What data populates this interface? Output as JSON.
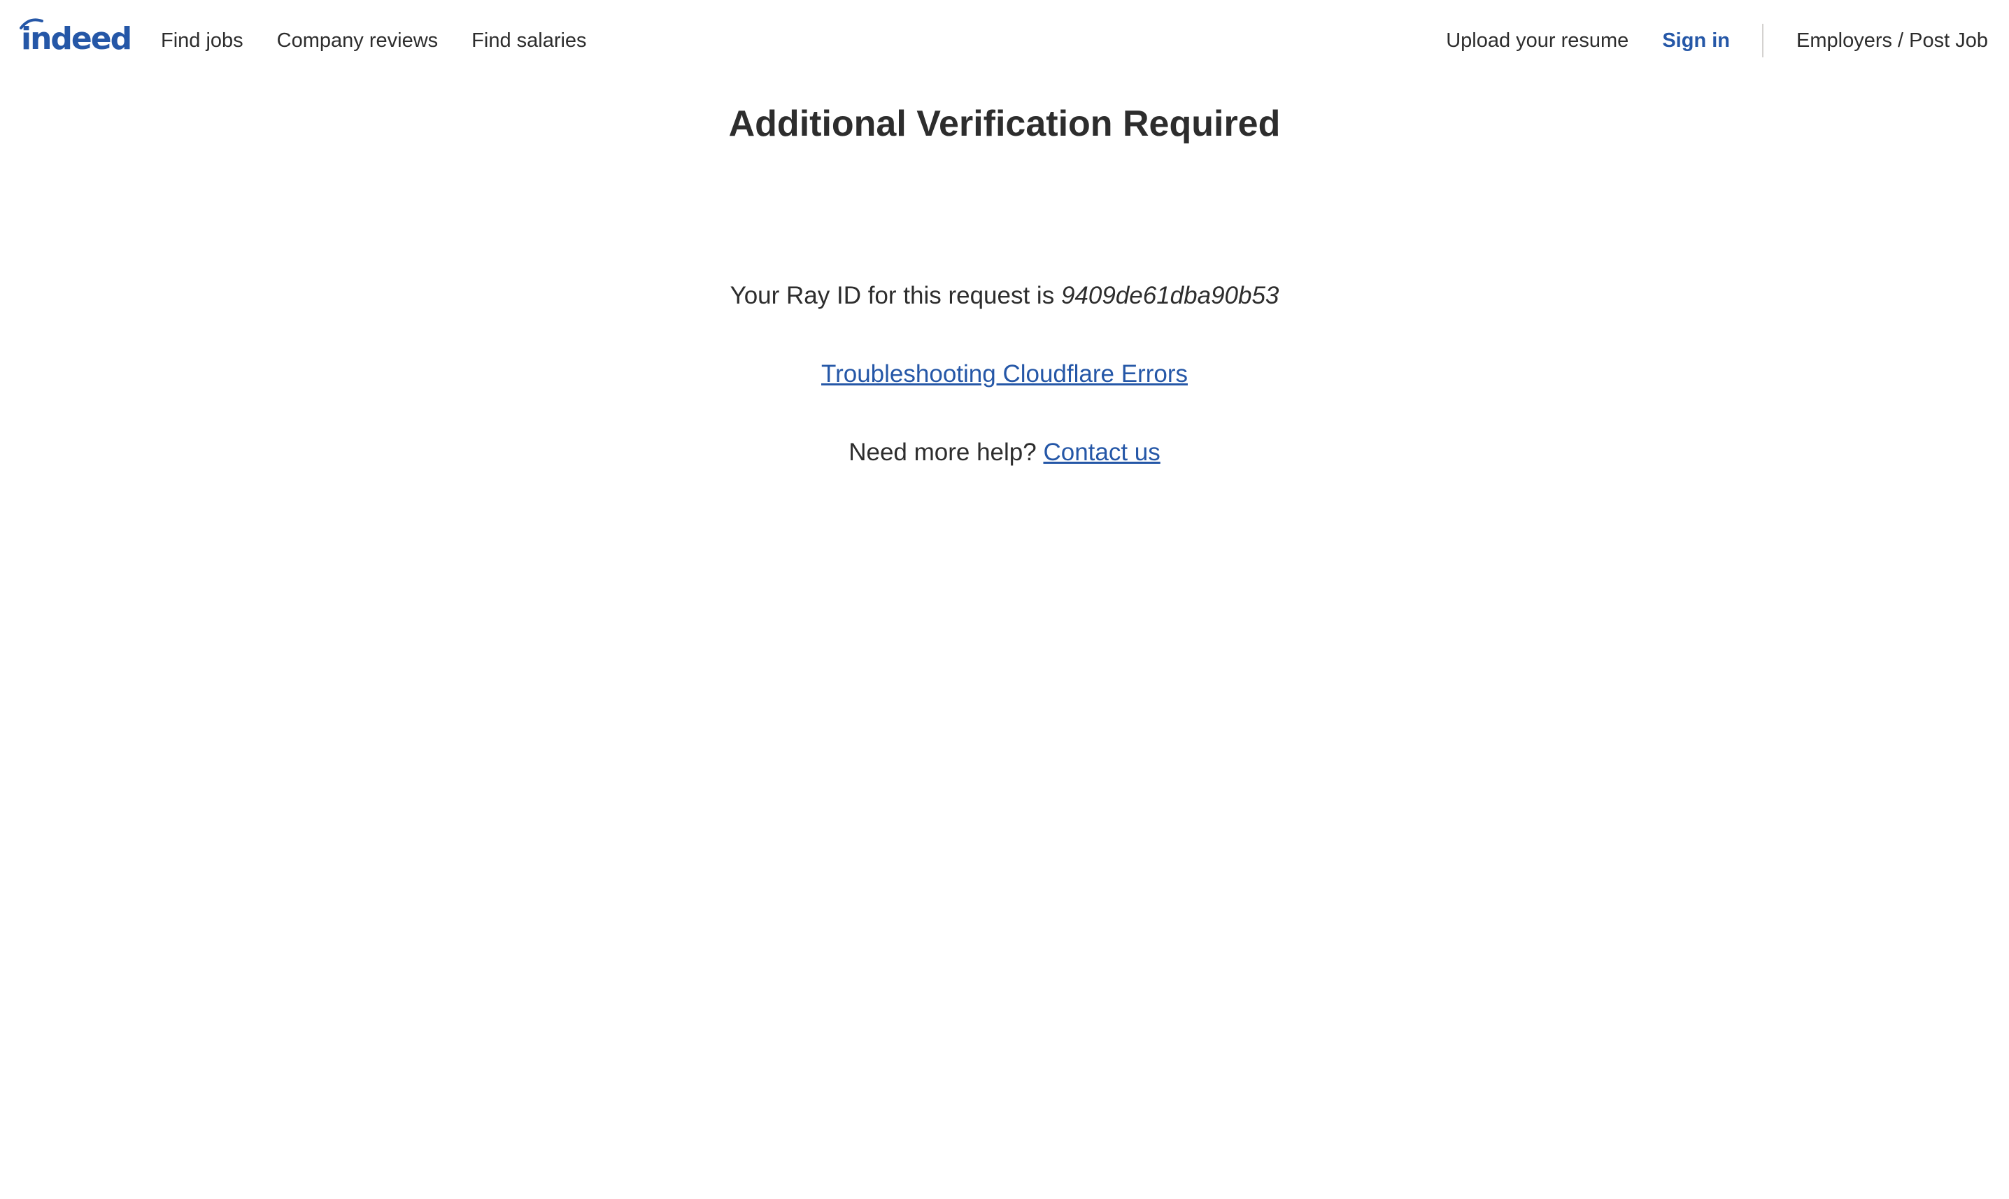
{
  "header": {
    "logo_text": "indeed",
    "nav_left": {
      "find_jobs": "Find jobs",
      "company_reviews": "Company reviews",
      "find_salaries": "Find salaries"
    },
    "nav_right": {
      "upload_resume": "Upload your resume",
      "sign_in": "Sign in",
      "employers": "Employers / Post Job"
    }
  },
  "main": {
    "title": "Additional Verification Required",
    "ray_prefix": "Your Ray ID for this request is",
    "ray_id": "9409de61dba90b53",
    "troubleshooting_link": "Troubleshooting Cloudflare Errors",
    "help_prefix": "Need more help?",
    "contact_link": "Contact us"
  },
  "colors": {
    "brand": "#2557a7",
    "text": "#2d2d2d",
    "divider": "#d4d2d0"
  }
}
